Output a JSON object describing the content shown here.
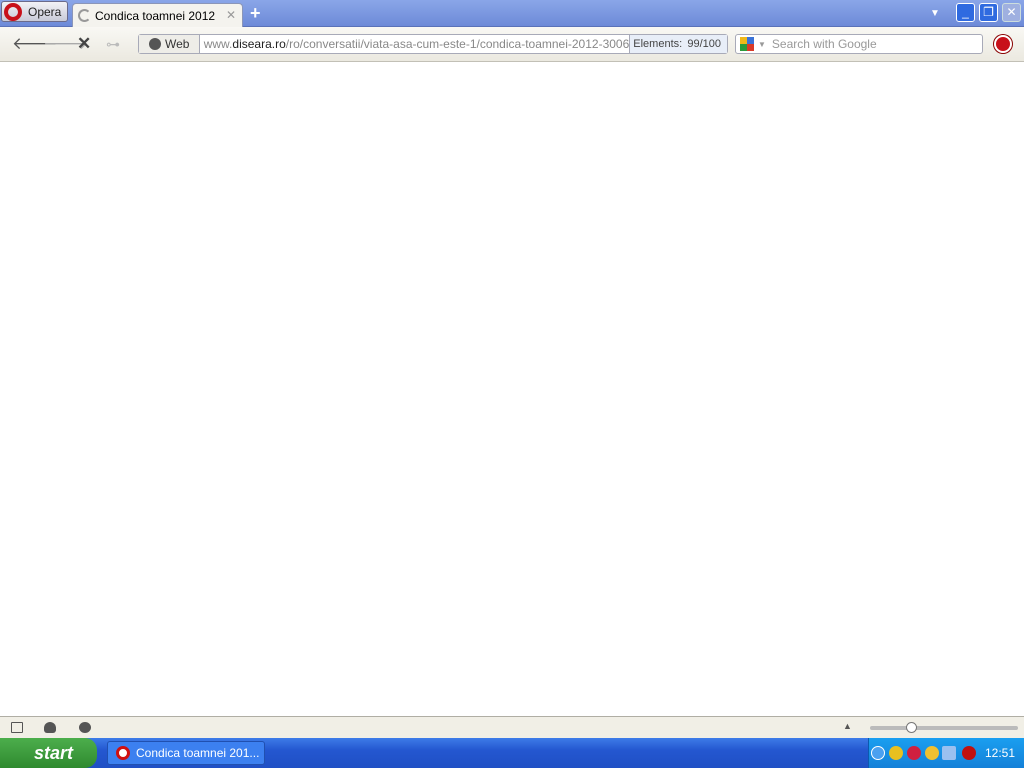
{
  "browser": {
    "menu_label": "Opera",
    "tabs": [
      {
        "title": "Condica toamnei 2012",
        "loading": true
      }
    ]
  },
  "toolbar": {
    "web_label": "Web",
    "url_domain_prefix": "www.",
    "url_domain": "diseara.ro",
    "url_path": "/ro/conversatii/viata-asa-cum-este-1/condica-toamnei-2012-3006",
    "elements_label": "Elements:",
    "elements_value": "99/100",
    "elements_progress_fraction": 0.99,
    "search_placeholder": "Search with Google"
  },
  "statusbar": {
    "zoom_slider_fraction": 0.28
  },
  "taskbar": {
    "start_label": "start",
    "tasks": [
      {
        "label": "Condica toamnei 201..."
      }
    ],
    "clock": "12:51"
  }
}
